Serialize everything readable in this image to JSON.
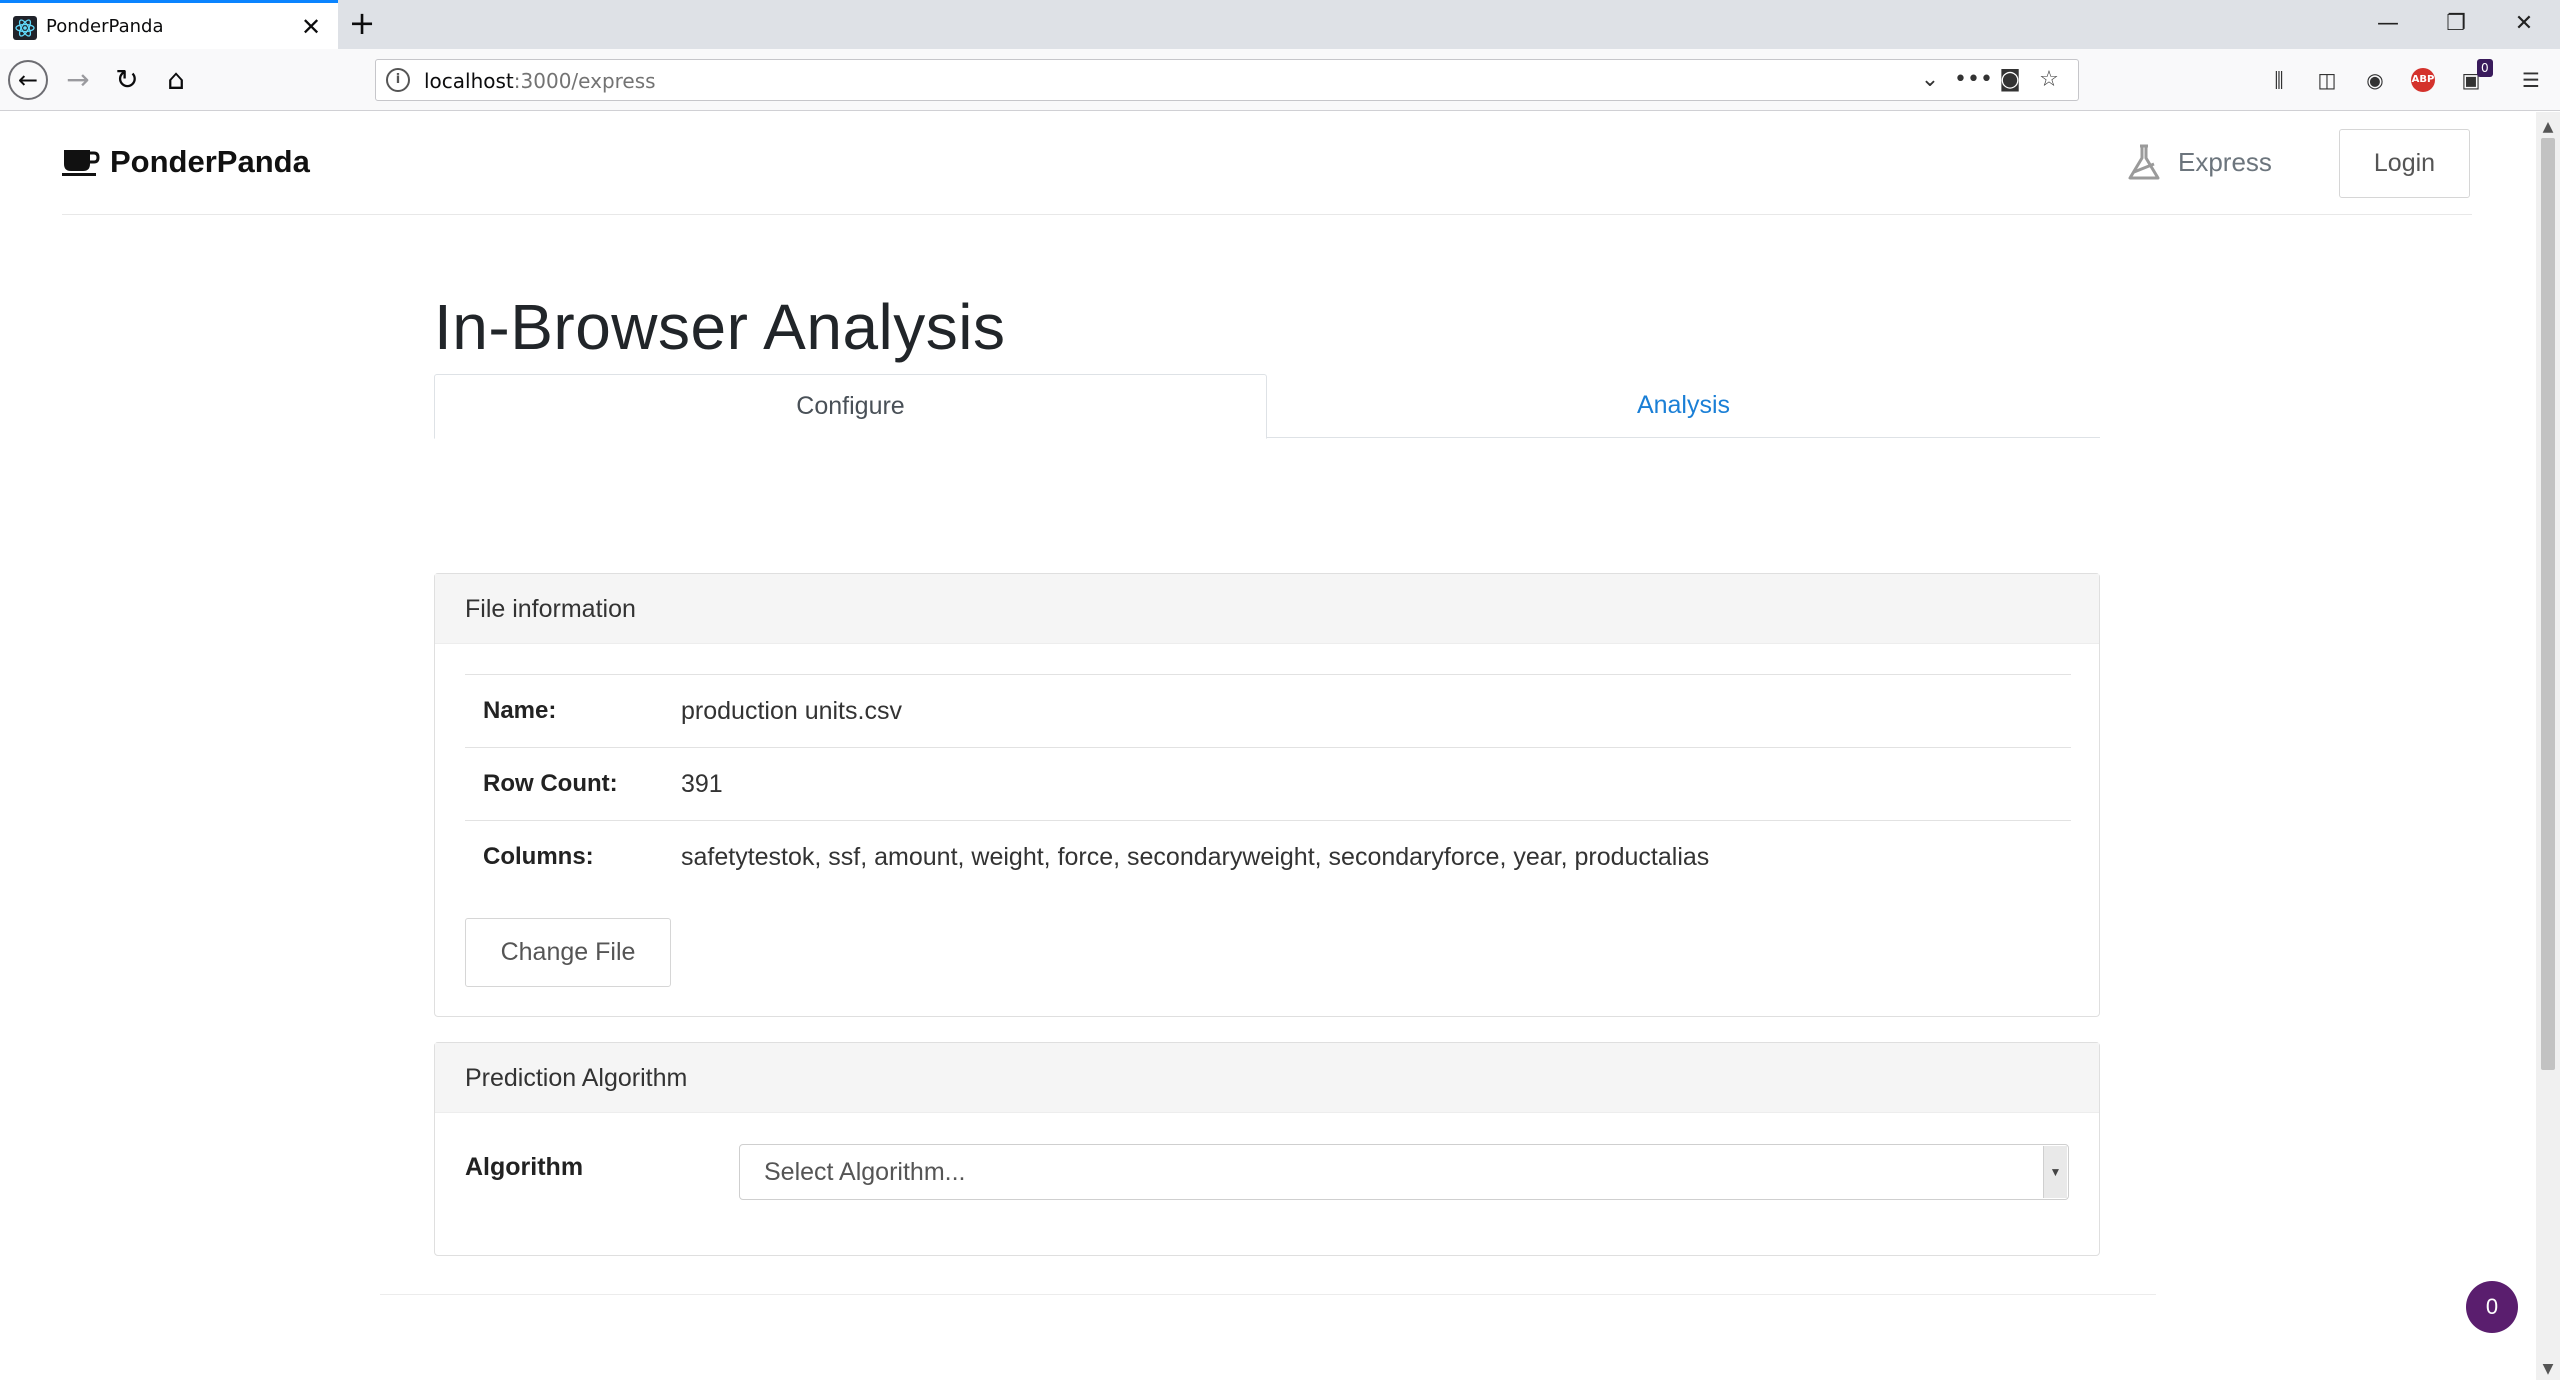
{
  "browser": {
    "tab_title": "PonderPanda",
    "tab_close": "✕",
    "new_tab": "+",
    "url_host": "localhost",
    "url_path": ":3000/express",
    "window_controls": {
      "minimize": "—",
      "restore": "❐",
      "close": "✕"
    },
    "extension_badge": "0",
    "abp_label": "ABP"
  },
  "header": {
    "brand": "PonderPanda",
    "express_label": "Express",
    "login_label": "Login"
  },
  "page": {
    "title": "In-Browser Analysis",
    "tabs": [
      {
        "label": "Configure",
        "active": true
      },
      {
        "label": "Analysis",
        "active": false
      }
    ]
  },
  "file_info": {
    "header": "File information",
    "rows": [
      {
        "label": "Name:",
        "value": "production units.csv"
      },
      {
        "label": "Row Count:",
        "value": "391"
      },
      {
        "label": "Columns:",
        "value": "safetytestok, ssf, amount, weight, force, secondaryweight, secondaryforce, year, productalias"
      }
    ],
    "change_button": "Change File"
  },
  "prediction": {
    "header": "Prediction Algorithm",
    "algorithm_label": "Algorithm",
    "select_placeholder": "Select Algorithm..."
  },
  "chat_badge": "0",
  "colors": {
    "accent_tab": "#0a84ff",
    "link": "#1a7fd6",
    "chat": "#5a1e6e"
  }
}
